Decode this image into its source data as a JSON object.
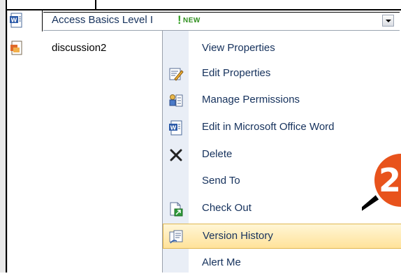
{
  "list": {
    "rows": [
      {
        "name": "Access Basics Level I",
        "badge_mark": "!",
        "badge": "NEW"
      },
      {
        "name": "discussion2"
      }
    ]
  },
  "context_menu": {
    "items": [
      {
        "label": "View Properties",
        "icon": "none"
      },
      {
        "label": "Edit Properties",
        "icon": "edit-properties-icon"
      },
      {
        "label": "Manage Permissions",
        "icon": "manage-permissions-icon"
      },
      {
        "label": "Edit in Microsoft Office Word",
        "icon": "word-document-icon"
      },
      {
        "label": "Delete",
        "icon": "delete-x-icon"
      },
      {
        "label": "Send To",
        "icon": "none"
      },
      {
        "label": "Check Out",
        "icon": "check-out-icon"
      },
      {
        "label": "Version History",
        "icon": "version-history-icon",
        "highlighted": true
      },
      {
        "label": "Alert Me",
        "icon": "none"
      }
    ]
  },
  "callout": {
    "number": "2"
  },
  "colors": {
    "menu_text": "#15315c",
    "menu_gutter": "#e9eef6",
    "highlight_top": "#fff6d6",
    "highlight_bottom": "#ffe29a",
    "new_badge": "#2f8f1e",
    "callout": "#e8531c"
  }
}
